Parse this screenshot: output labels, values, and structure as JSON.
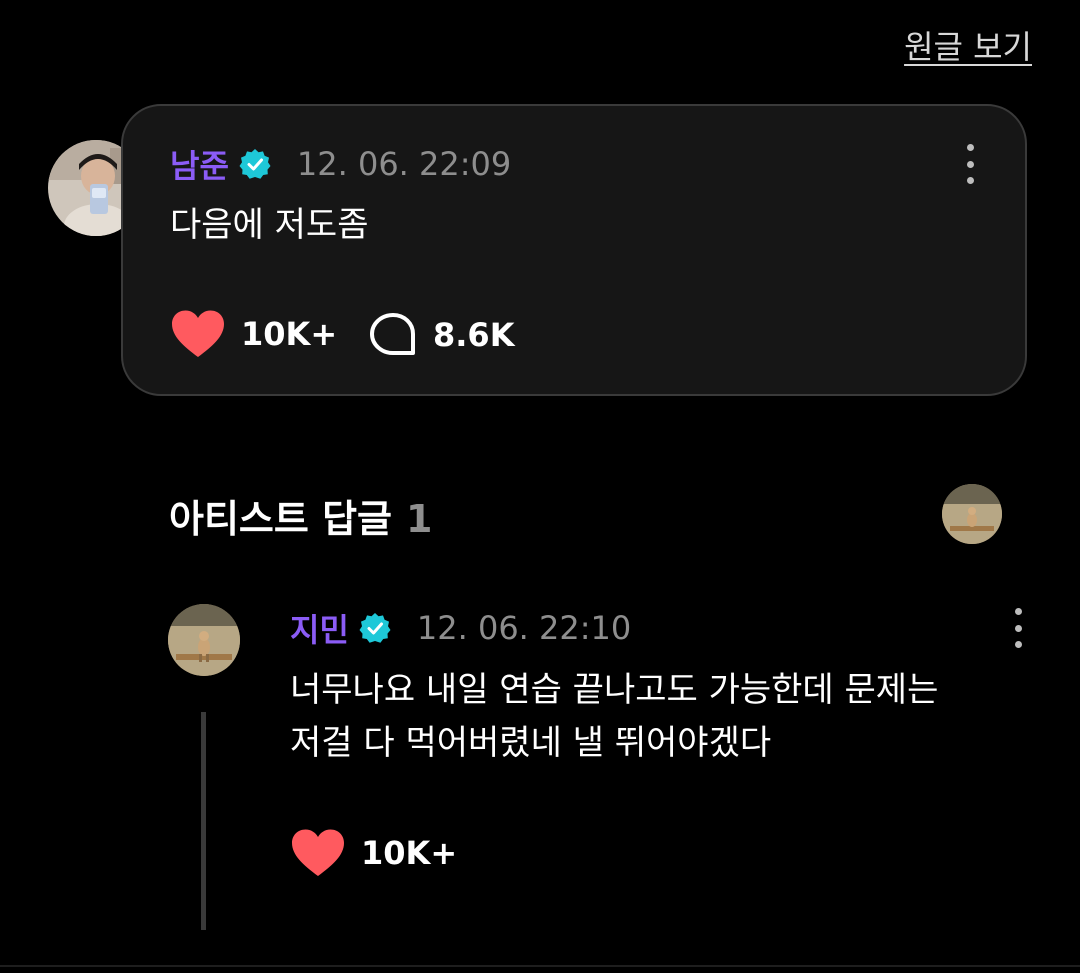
{
  "header": {
    "view_original_label": "원글 보기"
  },
  "comment": {
    "author": "남준",
    "timestamp": "12. 06. 22:09",
    "text": "다음에 저도좀",
    "likes": "10K+",
    "replies": "8.6K"
  },
  "artist_replies": {
    "title": "아티스트 답글",
    "count": "1"
  },
  "reply": {
    "author": "지민",
    "timestamp": "12. 06. 22:10",
    "text": "너무나요 내일 연습 끝나고도 가능한데 문제는\n저걸 다 먹어버렸네 낼 뛰어야겠다",
    "likes": "10K+"
  },
  "colors": {
    "background": "#000000",
    "card": "#161616",
    "author_purple": "#8b5cf6",
    "verified_teal": "#1ec8d8",
    "heart_red": "#ff5a5f",
    "muted_text": "#8e8e8e"
  },
  "icons": {
    "verified": "verified-badge-icon",
    "like": "heart-icon",
    "reply": "speech-bubble-icon",
    "more": "more-vertical-icon"
  }
}
